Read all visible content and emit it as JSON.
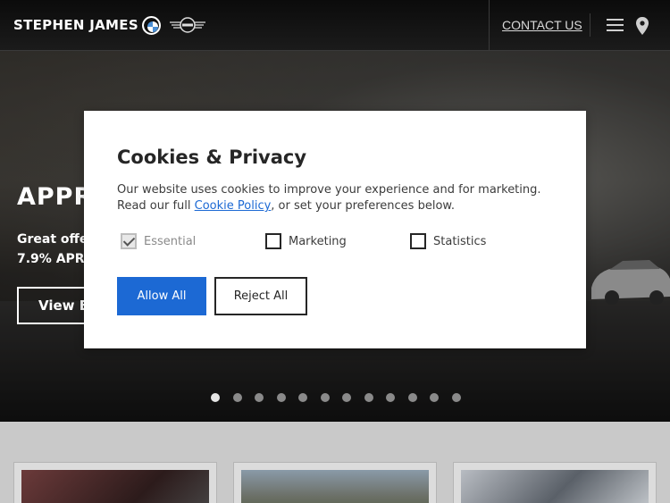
{
  "header": {
    "brand": "STEPHEN JAMES",
    "contact_link": "CONTACT US",
    "icons": [
      "bmw-logo",
      "mini-logo",
      "menu-icon",
      "location-icon"
    ]
  },
  "hero": {
    "title": "APPR",
    "subtitle_line1": "Great offer",
    "subtitle_line2": "7.9% APR",
    "cta_label": "View E",
    "carousel_total": 12,
    "carousel_active": 1
  },
  "cookie_modal": {
    "title": "Cookies & Privacy",
    "text_before_link": "Our website uses cookies to improve your experience and for marketing. Read our full ",
    "link_text": "Cookie Policy",
    "text_after_link": ", or set your preferences below.",
    "options": [
      {
        "label": "Essential",
        "checked": true,
        "disabled": true
      },
      {
        "label": "Marketing",
        "checked": false,
        "disabled": false
      },
      {
        "label": "Statistics",
        "checked": false,
        "disabled": false
      }
    ],
    "allow_label": "Allow All",
    "reject_label": "Reject All"
  },
  "colors": {
    "accent": "#1c69d4",
    "header_bg": "#111111"
  }
}
